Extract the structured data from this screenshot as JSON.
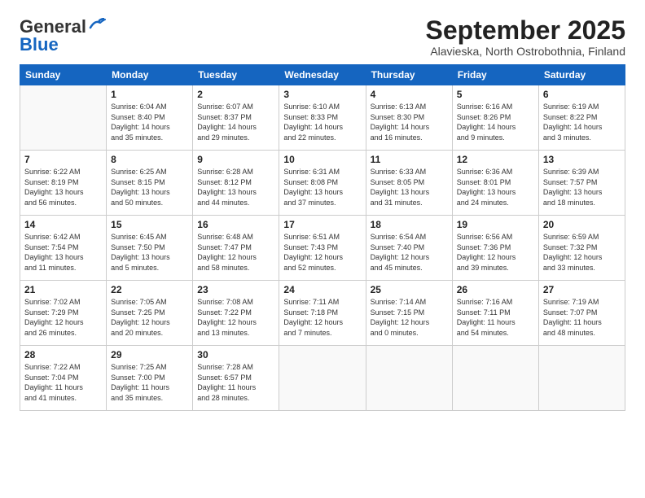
{
  "header": {
    "logo_general": "General",
    "logo_blue": "Blue",
    "month_title": "September 2025",
    "subtitle": "Alavieska, North Ostrobothnia, Finland"
  },
  "days_of_week": [
    "Sunday",
    "Monday",
    "Tuesday",
    "Wednesday",
    "Thursday",
    "Friday",
    "Saturday"
  ],
  "weeks": [
    [
      {
        "num": "",
        "info": ""
      },
      {
        "num": "1",
        "info": "Sunrise: 6:04 AM\nSunset: 8:40 PM\nDaylight: 14 hours\nand 35 minutes."
      },
      {
        "num": "2",
        "info": "Sunrise: 6:07 AM\nSunset: 8:37 PM\nDaylight: 14 hours\nand 29 minutes."
      },
      {
        "num": "3",
        "info": "Sunrise: 6:10 AM\nSunset: 8:33 PM\nDaylight: 14 hours\nand 22 minutes."
      },
      {
        "num": "4",
        "info": "Sunrise: 6:13 AM\nSunset: 8:30 PM\nDaylight: 14 hours\nand 16 minutes."
      },
      {
        "num": "5",
        "info": "Sunrise: 6:16 AM\nSunset: 8:26 PM\nDaylight: 14 hours\nand 9 minutes."
      },
      {
        "num": "6",
        "info": "Sunrise: 6:19 AM\nSunset: 8:22 PM\nDaylight: 14 hours\nand 3 minutes."
      }
    ],
    [
      {
        "num": "7",
        "info": "Sunrise: 6:22 AM\nSunset: 8:19 PM\nDaylight: 13 hours\nand 56 minutes."
      },
      {
        "num": "8",
        "info": "Sunrise: 6:25 AM\nSunset: 8:15 PM\nDaylight: 13 hours\nand 50 minutes."
      },
      {
        "num": "9",
        "info": "Sunrise: 6:28 AM\nSunset: 8:12 PM\nDaylight: 13 hours\nand 44 minutes."
      },
      {
        "num": "10",
        "info": "Sunrise: 6:31 AM\nSunset: 8:08 PM\nDaylight: 13 hours\nand 37 minutes."
      },
      {
        "num": "11",
        "info": "Sunrise: 6:33 AM\nSunset: 8:05 PM\nDaylight: 13 hours\nand 31 minutes."
      },
      {
        "num": "12",
        "info": "Sunrise: 6:36 AM\nSunset: 8:01 PM\nDaylight: 13 hours\nand 24 minutes."
      },
      {
        "num": "13",
        "info": "Sunrise: 6:39 AM\nSunset: 7:57 PM\nDaylight: 13 hours\nand 18 minutes."
      }
    ],
    [
      {
        "num": "14",
        "info": "Sunrise: 6:42 AM\nSunset: 7:54 PM\nDaylight: 13 hours\nand 11 minutes."
      },
      {
        "num": "15",
        "info": "Sunrise: 6:45 AM\nSunset: 7:50 PM\nDaylight: 13 hours\nand 5 minutes."
      },
      {
        "num": "16",
        "info": "Sunrise: 6:48 AM\nSunset: 7:47 PM\nDaylight: 12 hours\nand 58 minutes."
      },
      {
        "num": "17",
        "info": "Sunrise: 6:51 AM\nSunset: 7:43 PM\nDaylight: 12 hours\nand 52 minutes."
      },
      {
        "num": "18",
        "info": "Sunrise: 6:54 AM\nSunset: 7:40 PM\nDaylight: 12 hours\nand 45 minutes."
      },
      {
        "num": "19",
        "info": "Sunrise: 6:56 AM\nSunset: 7:36 PM\nDaylight: 12 hours\nand 39 minutes."
      },
      {
        "num": "20",
        "info": "Sunrise: 6:59 AM\nSunset: 7:32 PM\nDaylight: 12 hours\nand 33 minutes."
      }
    ],
    [
      {
        "num": "21",
        "info": "Sunrise: 7:02 AM\nSunset: 7:29 PM\nDaylight: 12 hours\nand 26 minutes."
      },
      {
        "num": "22",
        "info": "Sunrise: 7:05 AM\nSunset: 7:25 PM\nDaylight: 12 hours\nand 20 minutes."
      },
      {
        "num": "23",
        "info": "Sunrise: 7:08 AM\nSunset: 7:22 PM\nDaylight: 12 hours\nand 13 minutes."
      },
      {
        "num": "24",
        "info": "Sunrise: 7:11 AM\nSunset: 7:18 PM\nDaylight: 12 hours\nand 7 minutes."
      },
      {
        "num": "25",
        "info": "Sunrise: 7:14 AM\nSunset: 7:15 PM\nDaylight: 12 hours\nand 0 minutes."
      },
      {
        "num": "26",
        "info": "Sunrise: 7:16 AM\nSunset: 7:11 PM\nDaylight: 11 hours\nand 54 minutes."
      },
      {
        "num": "27",
        "info": "Sunrise: 7:19 AM\nSunset: 7:07 PM\nDaylight: 11 hours\nand 48 minutes."
      }
    ],
    [
      {
        "num": "28",
        "info": "Sunrise: 7:22 AM\nSunset: 7:04 PM\nDaylight: 11 hours\nand 41 minutes."
      },
      {
        "num": "29",
        "info": "Sunrise: 7:25 AM\nSunset: 7:00 PM\nDaylight: 11 hours\nand 35 minutes."
      },
      {
        "num": "30",
        "info": "Sunrise: 7:28 AM\nSunset: 6:57 PM\nDaylight: 11 hours\nand 28 minutes."
      },
      {
        "num": "",
        "info": ""
      },
      {
        "num": "",
        "info": ""
      },
      {
        "num": "",
        "info": ""
      },
      {
        "num": "",
        "info": ""
      }
    ]
  ]
}
